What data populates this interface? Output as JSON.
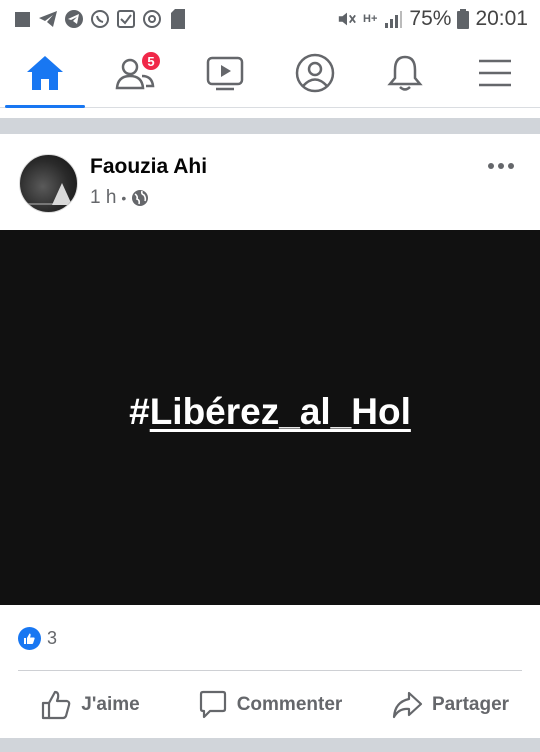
{
  "status_bar": {
    "battery": "75%",
    "time": "20:01",
    "network": "H+",
    "left_icons": [
      "square-icon",
      "telegram-icon",
      "telegram-icon",
      "whatsapp-icon",
      "checkbox-icon",
      "chrome-icon",
      "sim-icon"
    ]
  },
  "nav": {
    "items": [
      {
        "name": "home",
        "icon": "home-icon",
        "active": true
      },
      {
        "name": "friends",
        "icon": "friends-icon",
        "badge": "5"
      },
      {
        "name": "watch",
        "icon": "video-icon"
      },
      {
        "name": "profile",
        "icon": "profile-icon"
      },
      {
        "name": "notifications",
        "icon": "bell-icon"
      },
      {
        "name": "menu",
        "icon": "menu-icon"
      }
    ],
    "accent": "#1877f2"
  },
  "post": {
    "author": "Faouzia Ahi",
    "time": "1 h",
    "separator": "•",
    "privacy_icon": "globe-icon",
    "image_text_prefix": "#",
    "image_text_link": "Libérez_al_Hol",
    "image_bg": "#111111",
    "reaction_count": "3"
  },
  "actions": {
    "like": "J'aime",
    "comment": "Commenter",
    "share": "Partager"
  }
}
